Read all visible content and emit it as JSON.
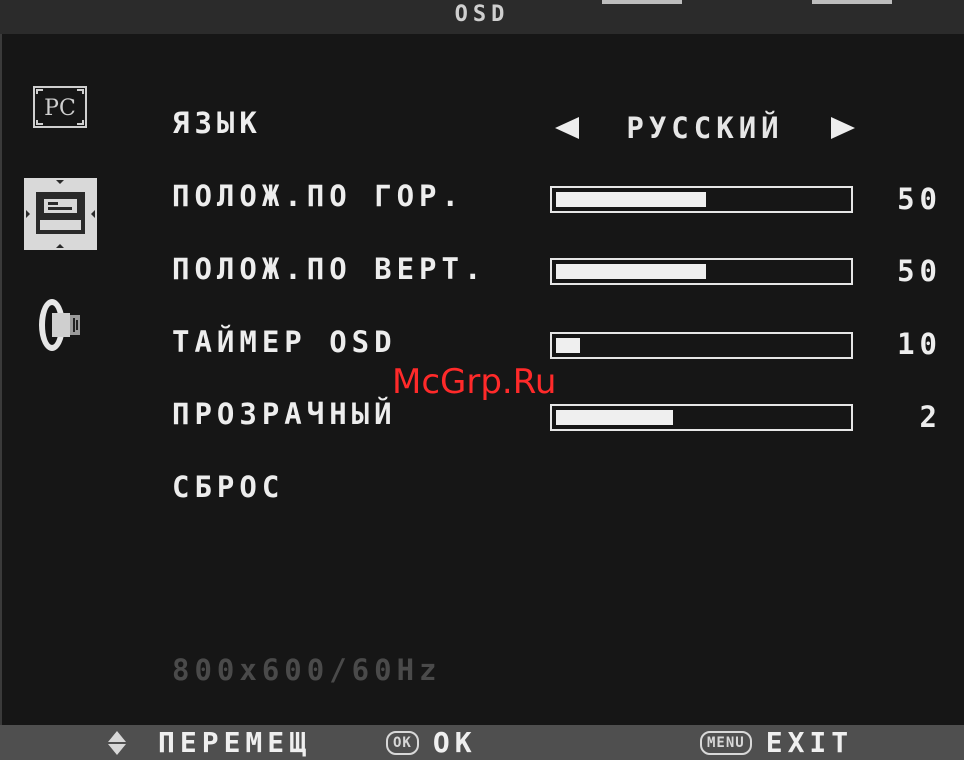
{
  "header": {
    "title": "OSD"
  },
  "sidebar": {
    "items": [
      {
        "name": "pc-icon",
        "label": "PC"
      },
      {
        "name": "position-icon"
      },
      {
        "name": "sound-icon"
      }
    ]
  },
  "menu": {
    "language": {
      "label": "ЯЗЫК",
      "value": "РУССКИЙ"
    },
    "h_position": {
      "label": "ПОЛОЖ.ПО ГОР.",
      "value": "50",
      "fraction": 0.5
    },
    "v_position": {
      "label": "ПОЛОЖ.ПО ВЕРТ.",
      "value": "50",
      "fraction": 0.5
    },
    "osd_timer": {
      "label": "ТАЙМЕР OSD",
      "value": "10",
      "fraction": 0.08
    },
    "transparency": {
      "label": "ПРОЗРАЧНЫЙ",
      "value": "2",
      "fraction": 0.39
    },
    "reset": {
      "label": "СБРОС"
    }
  },
  "resolution": "800x600/60Hz",
  "watermark": "McGrp.Ru",
  "footer": {
    "move_label": "ПЕРЕМЕЩ",
    "ok_key": "OK",
    "ok_label": "OK",
    "menu_key": "MENU",
    "exit_label": "EXIT"
  },
  "colors": {
    "background": "#171717",
    "text": "#ededed",
    "footer": "#4f4f4f",
    "watermark": "#ff2a2a"
  }
}
